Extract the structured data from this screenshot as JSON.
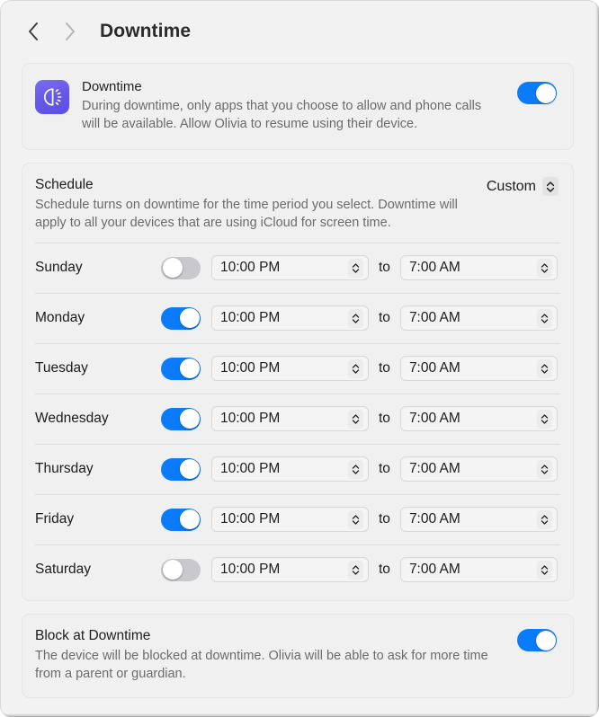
{
  "header": {
    "back_icon": "chevron-left-icon",
    "forward_icon": "chevron-right-icon",
    "title": "Downtime"
  },
  "downtime": {
    "icon": "downtime-app-icon",
    "title": "Downtime",
    "description": "During downtime, only apps that you choose to allow and phone calls will be available. Allow Olivia to resume using their device.",
    "enabled": true
  },
  "schedule": {
    "title": "Schedule",
    "description": "Schedule turns on downtime for the time period you select. Downtime will apply to all your devices that are using iCloud for screen time.",
    "mode_value": "Custom",
    "mode_icon": "up-down-chevron-icon",
    "to_label": "to",
    "stepper_icon": "up-down-chevron-icon",
    "days": [
      {
        "label": "Sunday",
        "enabled": false,
        "start": "10:00 PM",
        "end": "7:00 AM"
      },
      {
        "label": "Monday",
        "enabled": true,
        "start": "10:00 PM",
        "end": "7:00 AM"
      },
      {
        "label": "Tuesday",
        "enabled": true,
        "start": "10:00 PM",
        "end": "7:00 AM"
      },
      {
        "label": "Wednesday",
        "enabled": true,
        "start": "10:00 PM",
        "end": "7:00 AM"
      },
      {
        "label": "Thursday",
        "enabled": true,
        "start": "10:00 PM",
        "end": "7:00 AM"
      },
      {
        "label": "Friday",
        "enabled": true,
        "start": "10:00 PM",
        "end": "7:00 AM"
      },
      {
        "label": "Saturday",
        "enabled": false,
        "start": "10:00 PM",
        "end": "7:00 AM"
      }
    ]
  },
  "block_at_downtime": {
    "title": "Block at Downtime",
    "description": "The device will be blocked at downtime. Olivia will be able to ask for more time from a parent or guardian.",
    "enabled": true
  },
  "colors": {
    "toggle_on": "#0a7cfb",
    "toggle_off": "#c9c9cd",
    "app_icon": "#6457e8",
    "window_bg": "#f2f2f2",
    "card_bg": "#f0f0f0"
  }
}
